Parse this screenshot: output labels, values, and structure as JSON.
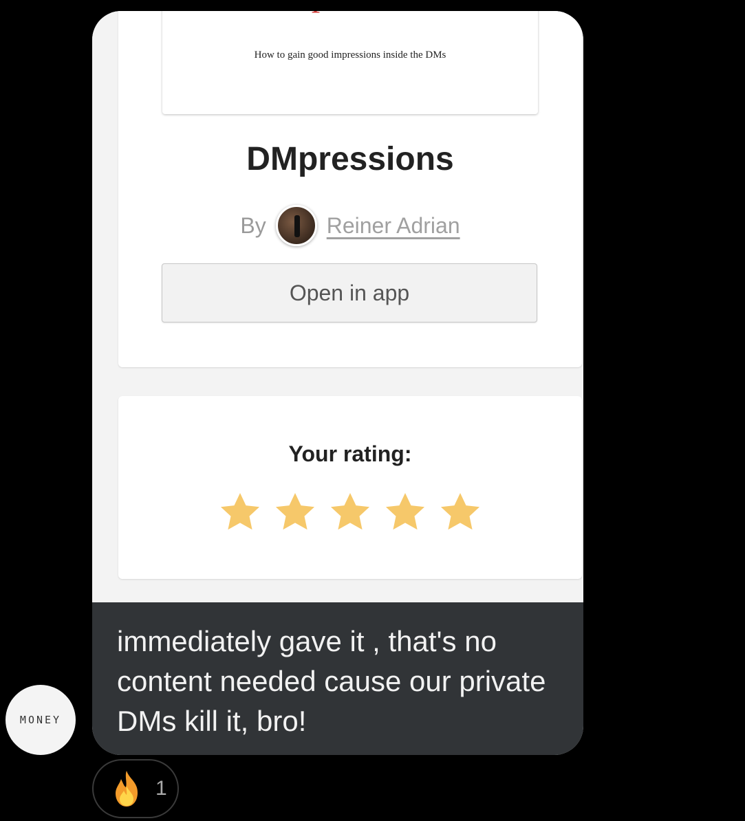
{
  "book": {
    "cover_title_dm": "DM",
    "cover_title_rest": "pressions",
    "cover_subtitle": "How to gain good impressions inside the DMs",
    "title": "DMpressions",
    "by_label": "By",
    "author": "Reiner Adrian",
    "open_button": "Open in app"
  },
  "rating": {
    "label": "Your rating:",
    "value": 5,
    "max": 5,
    "star_color": "#f6c86a"
  },
  "message": {
    "text": "immediately gave it , that's no content needed cause our private DMs kill it, bro!"
  },
  "sender": {
    "avatar_text": "MONEY"
  },
  "reaction": {
    "icon": "fire-icon",
    "count": "1"
  }
}
